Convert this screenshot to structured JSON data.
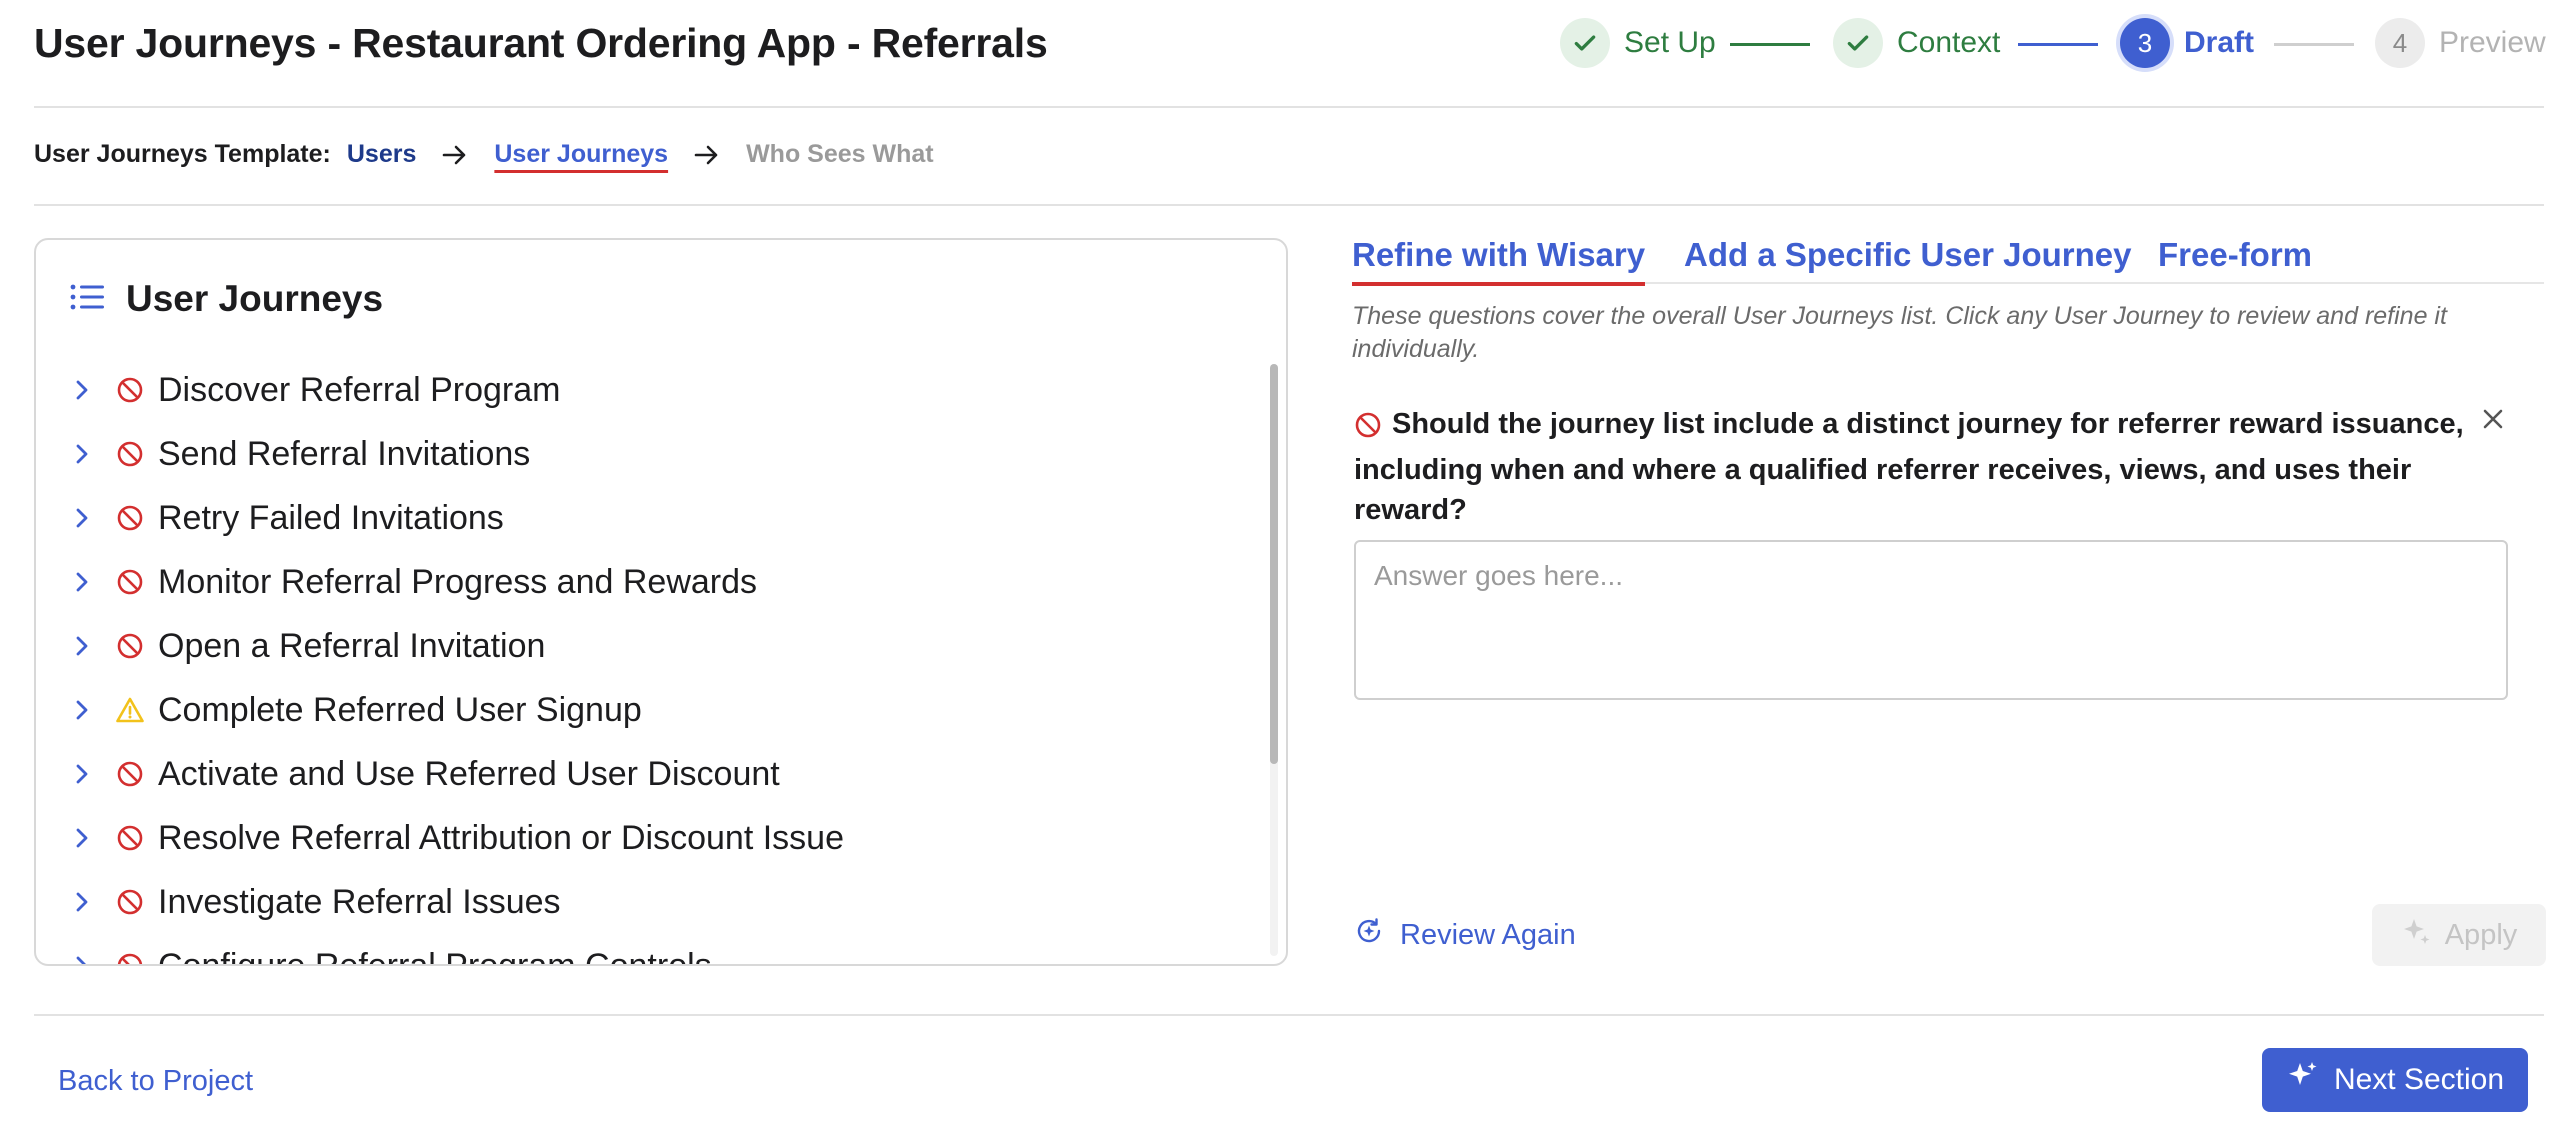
{
  "header": {
    "title": "User Journeys - Restaurant Ordering App - Referrals",
    "steps": [
      {
        "label": "Set Up",
        "state": "done",
        "marker": "check-icon"
      },
      {
        "label": "Context",
        "state": "done",
        "marker": "check-icon"
      },
      {
        "label": "Draft",
        "state": "active",
        "marker": "3"
      },
      {
        "label": "Preview",
        "state": "todo",
        "marker": "4"
      }
    ]
  },
  "breadcrumb": {
    "label": "User Journeys Template:",
    "items": [
      "Users",
      "User Journeys",
      "Who Sees What"
    ],
    "current": "User Journeys"
  },
  "journeys": {
    "title": "User Journeys",
    "icon": "list-icon",
    "items": [
      {
        "name": "Discover Referral Program",
        "status": "blocked"
      },
      {
        "name": "Send Referral Invitations",
        "status": "blocked"
      },
      {
        "name": "Retry Failed Invitations",
        "status": "blocked"
      },
      {
        "name": "Monitor Referral Progress and Rewards",
        "status": "blocked"
      },
      {
        "name": "Open a Referral Invitation",
        "status": "blocked"
      },
      {
        "name": "Complete Referred User Signup",
        "status": "warning"
      },
      {
        "name": "Activate and Use Referred User Discount",
        "status": "blocked"
      },
      {
        "name": "Resolve Referral Attribution or Discount Issue",
        "status": "blocked"
      },
      {
        "name": "Investigate Referral Issues",
        "status": "blocked"
      },
      {
        "name": "Configure Referral Program Controls",
        "status": "blocked"
      }
    ]
  },
  "refine": {
    "tabs": [
      "Refine with Wisary",
      "Add a Specific User Journey",
      "Free-form"
    ],
    "active_tab": "Refine with Wisary",
    "hint": "These questions cover the overall User Journeys list. Click any User Journey to review and refine it individually.",
    "question": "Should the journey list include a distinct journey for referrer reward issuance, including when and where a qualified referrer receives, views, and uses their reward?",
    "answer_placeholder": "Answer goes here...",
    "answer_value": "",
    "review_again_label": "Review Again",
    "apply_label": "Apply"
  },
  "footer": {
    "back_label": "Back to Project",
    "next_label": "Next Section"
  },
  "colors": {
    "accent": "#3f5fd0",
    "success": "#2e7d40",
    "danger": "#d32f2f",
    "warning": "#f2c21b"
  }
}
